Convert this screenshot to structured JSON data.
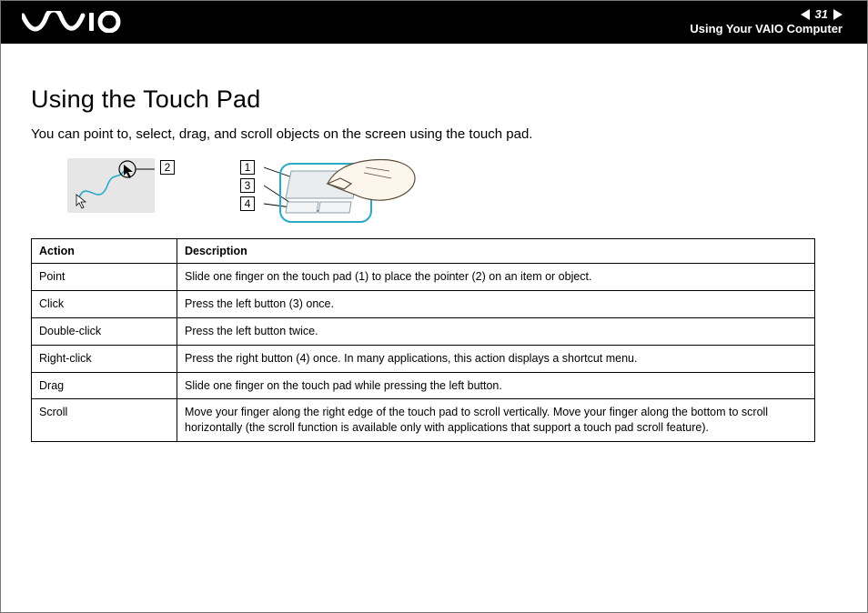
{
  "header": {
    "page_number": "31",
    "section": "Using Your VAIO Computer"
  },
  "title": "Using the Touch Pad",
  "intro": "You can point to, select, drag, and scroll objects on the screen using the touch pad.",
  "callouts": {
    "c1": "1",
    "c2": "2",
    "c3": "3",
    "c4": "4"
  },
  "table": {
    "head_action": "Action",
    "head_desc": "Description",
    "rows": [
      {
        "action": "Point",
        "desc": "Slide one finger on the touch pad (1) to place the pointer (2) on an item or object."
      },
      {
        "action": "Click",
        "desc": "Press the left button (3) once."
      },
      {
        "action": "Double-click",
        "desc": "Press the left button twice."
      },
      {
        "action": "Right-click",
        "desc": "Press the right button (4) once. In many applications, this action displays a shortcut menu."
      },
      {
        "action": "Drag",
        "desc": "Slide one finger on the touch pad while pressing the left button."
      },
      {
        "action": "Scroll",
        "desc": "Move your finger along the right edge of the touch pad to scroll vertically. Move your finger along the bottom to scroll horizontally (the scroll function is available only with applications that support a touch pad scroll feature)."
      }
    ]
  }
}
